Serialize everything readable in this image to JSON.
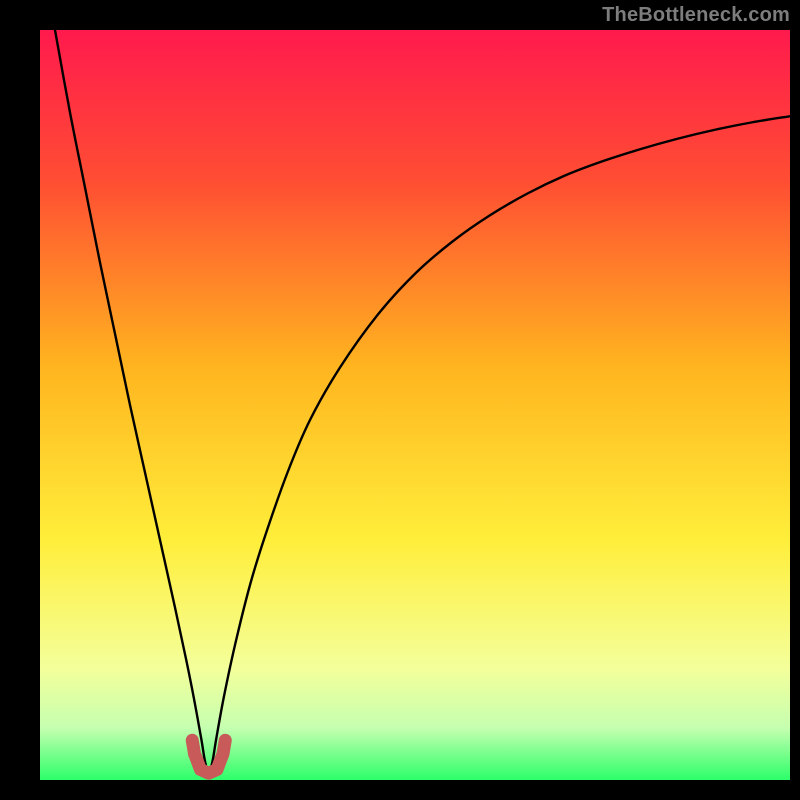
{
  "watermark": "TheBottleneck.com",
  "colors": {
    "frame_bg": "#000000",
    "gradient_top": "#ff1a4d",
    "gradient_mid_upper": "#ff6a2a",
    "gradient_mid": "#ffc81e",
    "gradient_mid_lower": "#ffff66",
    "gradient_pale": "#eaffc2",
    "gradient_bottom": "#2cff6a",
    "curve": "#000000",
    "marker_stroke": "#c85a5a",
    "marker_fill": "none"
  },
  "chart_data": {
    "type": "line",
    "title": "",
    "xlabel": "",
    "ylabel": "",
    "xlim": [
      0,
      100
    ],
    "ylim": [
      0,
      100
    ],
    "grid": false,
    "legend": false,
    "notch_x": 22.5,
    "series": [
      {
        "name": "bottleneck-curve",
        "x": [
          2,
          4,
          6,
          8,
          10,
          12,
          14,
          16,
          18,
          19.5,
          20.5,
          21.5,
          22,
          22.5,
          23,
          23.5,
          24.5,
          26,
          28,
          30,
          33,
          36,
          40,
          45,
          50,
          55,
          60,
          65,
          70,
          75,
          80,
          85,
          90,
          95,
          100
        ],
        "y": [
          100,
          89,
          79,
          69,
          59.5,
          50,
          41,
          32,
          23,
          16,
          11,
          5.5,
          2.5,
          1,
          2.5,
          5.5,
          11,
          18,
          26,
          32.5,
          41,
          48,
          55,
          62,
          67.5,
          71.8,
          75.3,
          78.2,
          80.6,
          82.5,
          84.1,
          85.5,
          86.7,
          87.7,
          88.5
        ]
      }
    ],
    "markers": {
      "name": "optimal-range",
      "shape": "u",
      "points_x": [
        20.3,
        20.6,
        21.4,
        22.5,
        23.6,
        24.4,
        24.7
      ],
      "points_y": [
        5.3,
        3.5,
        1.4,
        0.9,
        1.4,
        3.5,
        5.3
      ]
    },
    "background_gradient_stops": [
      {
        "offset": 0.0,
        "color": "#ff1a4d"
      },
      {
        "offset": 0.2,
        "color": "#ff4d33"
      },
      {
        "offset": 0.45,
        "color": "#ffb51f"
      },
      {
        "offset": 0.68,
        "color": "#ffee3a"
      },
      {
        "offset": 0.85,
        "color": "#f4ff9a"
      },
      {
        "offset": 0.93,
        "color": "#c6ffb0"
      },
      {
        "offset": 1.0,
        "color": "#2cff6a"
      }
    ]
  }
}
